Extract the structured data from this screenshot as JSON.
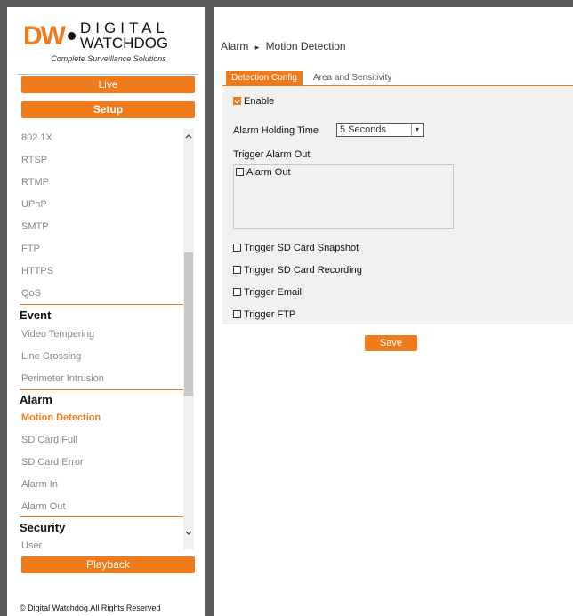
{
  "brand": {
    "dw": "DW",
    "digital": "DIGITAL",
    "watchdog": "WATCHDOG",
    "tagline": "Complete Surveillance Solutions"
  },
  "nav": {
    "live": "Live",
    "setup": "Setup",
    "playback": "Playback"
  },
  "menu": {
    "network_items": [
      "802.1X",
      "RTSP",
      "RTMP",
      "UPnP",
      "SMTP",
      "FTP",
      "HTTPS",
      "QoS"
    ],
    "event_header": "Event",
    "event_items": [
      "Video Tempering",
      "Line Crossing",
      "Perimeter Intrusion"
    ],
    "alarm_header": "Alarm",
    "alarm_items": [
      "Motion Detection",
      "SD Card Full",
      "SD Card Error",
      "Alarm In",
      "Alarm Out"
    ],
    "security_header": "Security",
    "security_items": [
      "User"
    ],
    "active_item": "Motion Detection"
  },
  "footer": {
    "copyright": "© Digital Watchdog.All Rights Reserved"
  },
  "breadcrumb": {
    "section": "Alarm",
    "separator": "▸",
    "page": "Motion Detection"
  },
  "tabs": {
    "detection_config": "Detection Config",
    "area_sensitivity": "Area and Sensitivity"
  },
  "form": {
    "enable_label": "Enable",
    "enable_checked": true,
    "holding_time_label": "Alarm Holding Time",
    "holding_time_value": "5 Seconds",
    "trigger_alarm_out_label": "Trigger Alarm Out",
    "alarm_out_label": "Alarm Out",
    "snapshot_label": "Trigger SD Card Snapshot",
    "recording_label": "Trigger SD Card Recording",
    "email_label": "Trigger Email",
    "ftp_label": "Trigger FTP",
    "save_label": "Save"
  },
  "colors": {
    "accent": "#f07b1c",
    "frame": "#5a5a5a",
    "panel_bg": "#f1f1f1"
  },
  "icons": {
    "scroll_up": "chevron-up-icon",
    "scroll_down": "chevron-down-icon",
    "select_arrow": "chevron-down-icon",
    "breadcrumb_sep": "triangle-right-icon"
  }
}
